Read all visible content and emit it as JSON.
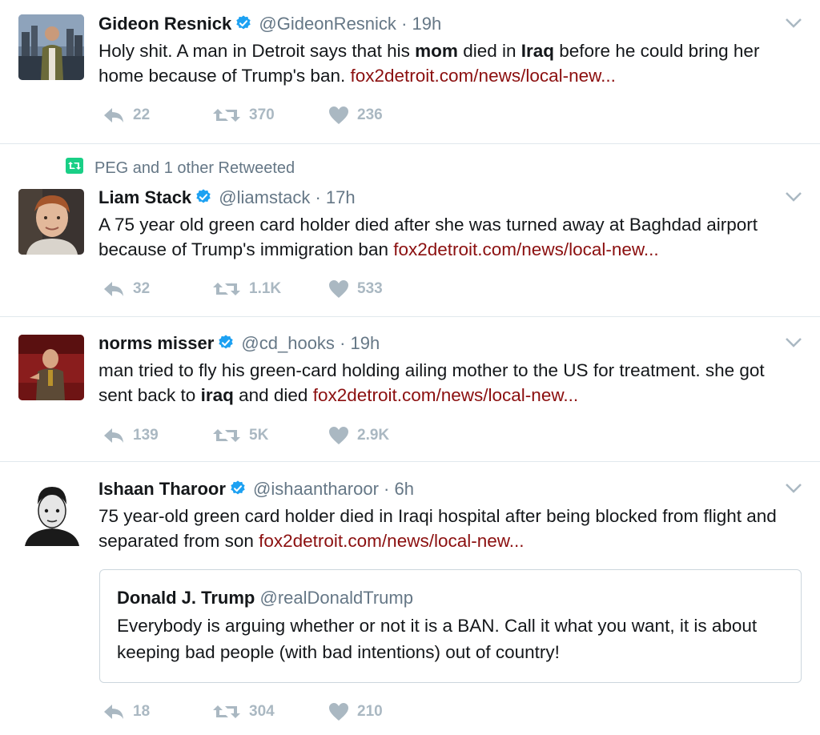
{
  "tweets": [
    {
      "name": "Gideon Resnick",
      "handle": "@GideonResnick",
      "time": "19h",
      "text_parts": [
        "Holy shit. A man in Detroit says that his ",
        "mom",
        " died in ",
        "Iraq",
        " before he could bring her home because of Trump's ban. "
      ],
      "link": "fox2detroit.com/news/local-new...",
      "replies": "22",
      "retweets": "370",
      "likes": "236"
    },
    {
      "context": "PEG and 1 other Retweeted",
      "name": "Liam Stack",
      "handle": "@liamstack",
      "time": "17h",
      "text": "A 75 year old green card holder died after she was turned away at Baghdad airport because of Trump's immigration ban ",
      "link": "fox2detroit.com/news/local-new...",
      "replies": "32",
      "retweets": "1.1K",
      "likes": "533"
    },
    {
      "name": "norms misser",
      "handle": "@cd_hooks",
      "time": "19h",
      "text_parts": [
        "man tried to fly his green-card holding ailing mother to the US for treatment. she got sent back to ",
        "iraq",
        " and died "
      ],
      "link": "fox2detroit.com/news/local-new...",
      "replies": "139",
      "retweets": "5K",
      "likes": "2.9K"
    },
    {
      "name": "Ishaan Tharoor",
      "handle": "@ishaantharoor",
      "time": "6h",
      "text": "75 year-old green card holder died in Iraqi hospital after being blocked from flight and separated from son  ",
      "link": "fox2detroit.com/news/local-new...",
      "quote": {
        "name": "Donald J. Trump",
        "handle": "@realDonaldTrump",
        "text": "Everybody is arguing whether or not it is a BAN. Call it what you want, it is about keeping bad people (with bad intentions) out of country!"
      },
      "replies": "18",
      "retweets": "304",
      "likes": "210"
    }
  ],
  "separator": "·",
  "colors": {
    "link": "#8b0f0f",
    "verified": "#1da1f2",
    "action_gray": "#aab8c2",
    "meta_gray": "#657786",
    "retweet_green": "#19cf86"
  },
  "icons": [
    "verified-badge-icon",
    "reply-icon",
    "retweet-icon",
    "heart-icon",
    "chevron-down-icon"
  ]
}
